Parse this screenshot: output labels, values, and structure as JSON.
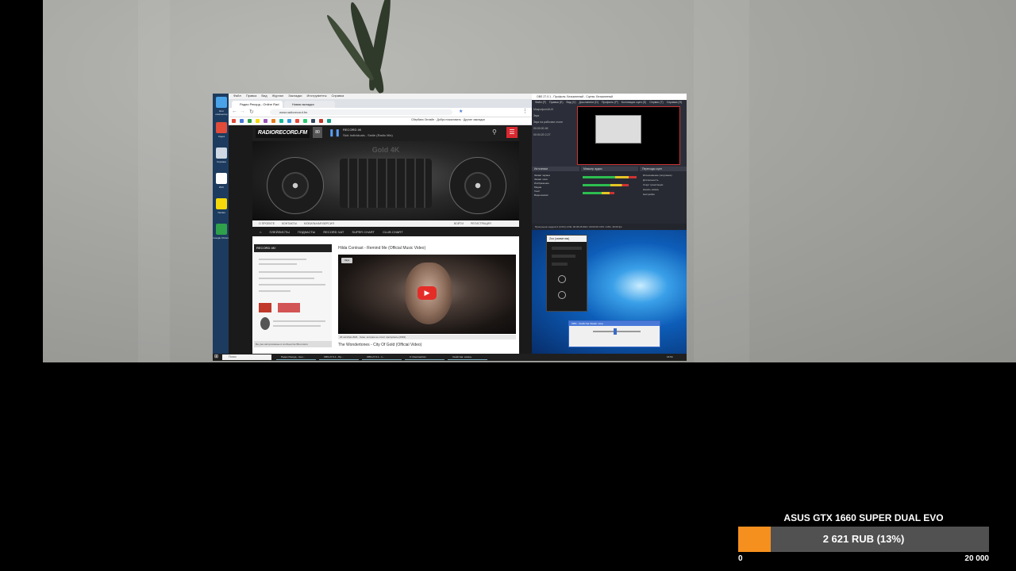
{
  "desktop_icons": [
    {
      "label": "Этот компьютер",
      "color": "#4aa3e8"
    },
    {
      "label": "Кодек",
      "color": "#e04b3a"
    },
    {
      "label": "Корзина",
      "color": "#cfd8e3"
    },
    {
      "label": "ИАС",
      "color": "#ffffff"
    },
    {
      "label": "Yandex",
      "color": "#f5d90a"
    },
    {
      "label": "Google Chrome",
      "color": "#2fa14a"
    }
  ],
  "browser": {
    "menubar": [
      "Файл",
      "Правка",
      "Вид",
      "Журнал",
      "Закладки",
      "Инструменты",
      "Справка"
    ],
    "tabs": [
      "Радио Рекорд - Online Rad",
      "Новая вкладка"
    ],
    "address": "www.radiorecord.fm",
    "bookmarks_text": "Сбербанк Онлайн · Добро пожаловать · Другие закладки"
  },
  "radio_site": {
    "logo": "RADIORECORD.FM",
    "volume": "80",
    "now_playing_label": "RECORD 4K",
    "now_playing_track": "Sick Individuals - Smile (Radio Mix)",
    "hero_station": "Gold 4K",
    "nav_top": [
      "О ПРОЕКТЕ",
      "КОНТАКТЫ",
      "МОБИЛЬНАЯ ВЕРСИЯ",
      "ВОЙТИ",
      "РЕГИСТРАЦИЯ"
    ],
    "nav_main": [
      "ПЛЕЙЛИСТЫ",
      "ПОДКАСТЫ",
      "RECORD ЧАТ",
      "SUPER CHART",
      "CLUB CHART"
    ],
    "widget_header": "RECORD 4K!",
    "widget_footer": "Вы уже авторизованы в сообществе ВКонтакте",
    "video_title": "Hilda Contrast - Remind Me (Official Music Video)",
    "video_badge": "Звук",
    "video_caption": "20 октября 2021 · Кино, которое не стоит пропускать (2019)",
    "video_title_2": "The Wondertones - City Of Gold (Official Video)"
  },
  "obs": {
    "title": "OBS 27.0.1 - Профиль: Безымянный - Сцены: Безымянный",
    "menubar": [
      "Файл (F)",
      "Правка (E)",
      "Вид (V)",
      "Док-панели (D)",
      "Профиль (P)",
      "Коллекция сцен (S)",
      "Сервис (T)",
      "Справка (H)"
    ],
    "left_stats": [
      "Микрофон/AUX",
      "Звук",
      "Звук на рабочем столе",
      "00:00:00 4K",
      "00:04:20 2.27"
    ],
    "dock_headers": [
      "Источники",
      "Микшер аудио",
      "Переходы сцен"
    ],
    "sources": [
      "Захват экрана",
      "Захват окна",
      "Изображение",
      "Медиа",
      "Текст",
      "Видеозахват"
    ],
    "transitions": [
      "Исчезновение (затухание)",
      "Длительность",
      "Старт трансляции",
      "Начать запись",
      "Настройки"
    ],
    "statusbar": "Пропущено кадров 0 (0.0%)   LIVE: 00:06:26   REC: 00:00:00   CPU: 4.8%, 30.00 fps"
  },
  "small_window_title": "Zoo (захватчик)",
  "dialog_title": "OBS - Свойства Захват окна",
  "taskbar": {
    "search_placeholder": "Поиск",
    "items": [
      "Радио Рекорд - Goo...",
      "OBS 27.0.1 - Пр...",
      "OBS 27.0.1 - 1...",
      "C:\\Users\\admin",
      "Свойства: запись"
    ],
    "clock": "16:54"
  },
  "donation": {
    "title": "ASUS GTX 1660 SUPER DUAL EVO",
    "progress_label": "2 621 RUB (13%)",
    "progress_fraction": 0.131,
    "min": "0",
    "max": "20 000",
    "track_color": "#515151",
    "fill_color": "#f5901e"
  }
}
